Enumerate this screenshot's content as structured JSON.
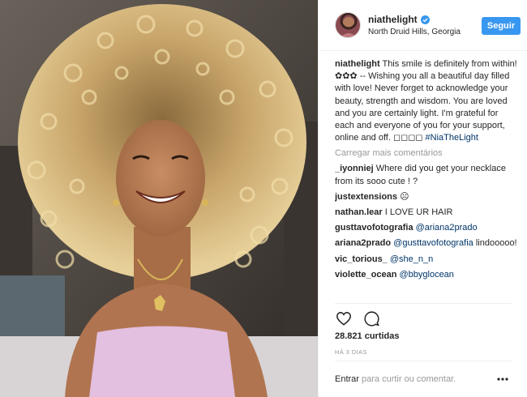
{
  "post": {
    "username": "niathelight",
    "location": "North Druid Hills, Georgia",
    "follow_label": "Seguir",
    "caption_text": "This smile is definitely from within! ✿✿✿ -- Wishing you all a beautiful day filled with love! Never forget to acknowledge your beauty, strength and wisdom. You are loved and you are certainly light. I'm grateful for each and everyone of you for your support, online and off. ◻◻◻◻ ",
    "caption_hashtag": "#NiaTheLight",
    "load_more_label": "Carregar mais comentários",
    "comments": [
      {
        "user": "_iyonniej",
        "text": "Where did you get your necklace from its sooo cute ! ?",
        "mention": ""
      },
      {
        "user": "justextensions",
        "text": "☹",
        "mention": ""
      },
      {
        "user": "nathan.lear",
        "text": "I LOVE UR HAIR",
        "mention": ""
      },
      {
        "user": "gusttavofotografia",
        "text": "",
        "mention": "@ariana2prado"
      },
      {
        "user": "ariana2prado",
        "text": "lindooooo!",
        "mention": "@gusttavofotografia"
      },
      {
        "user": "vic_torious_",
        "text": "",
        "mention": "@she_n_n"
      },
      {
        "user": "violette_ocean",
        "text": "",
        "mention": "@bbyglocean"
      }
    ],
    "likes": "28.821 curtidas",
    "time_ago": "HÁ 3 DIAS",
    "login_link": "Entrar",
    "login_rest": " para curtir ou comentar."
  },
  "icons": {
    "verified": "verified-badge-icon",
    "like": "heart-outline-icon",
    "comment": "speech-bubble-icon",
    "more": "ellipsis-icon"
  },
  "colors": {
    "accent": "#3897f0",
    "link": "#003569",
    "muted": "#999999",
    "text": "#262626"
  }
}
